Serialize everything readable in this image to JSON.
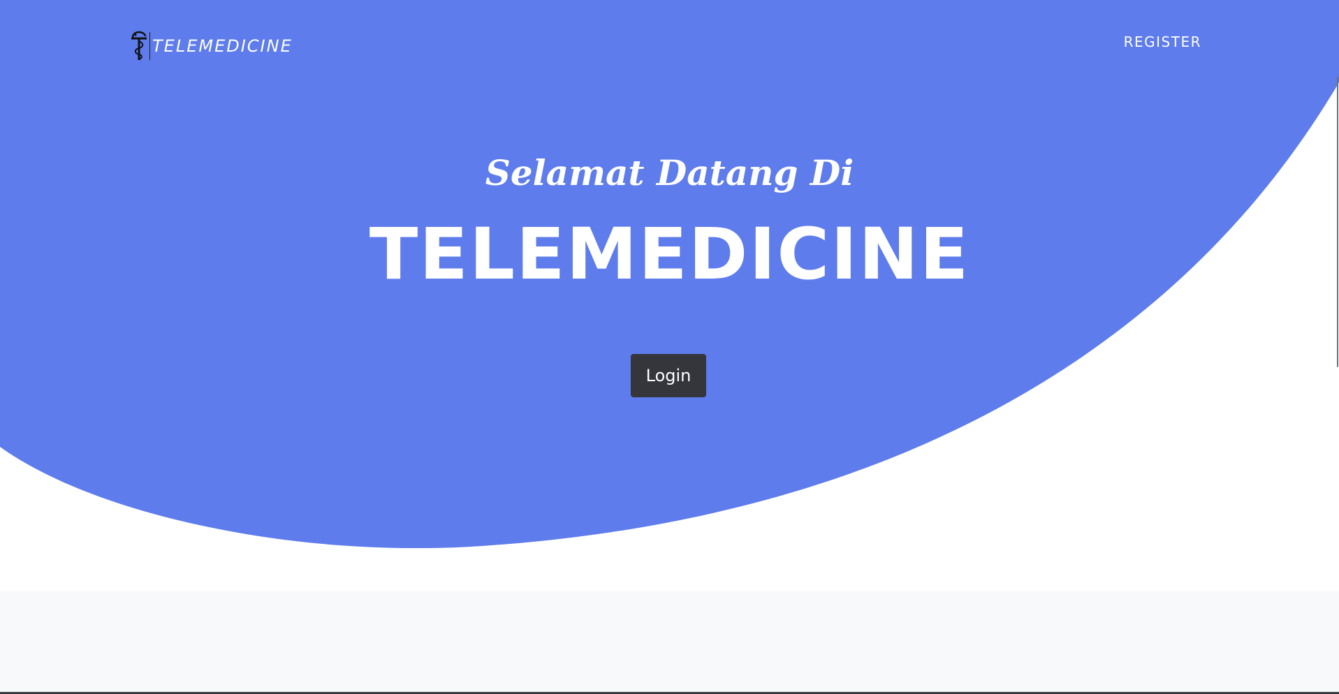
{
  "navbar": {
    "brand_text": "TELEMEDICINE",
    "brand_icon": "caduceus-logo-icon",
    "register_label": "REGISTER"
  },
  "hero": {
    "subtitle": "Selamat Datang Di",
    "title": "TELEMEDICINE",
    "login_label": "Login"
  },
  "colors": {
    "hero_blue": "#5e7ceb",
    "button_dark": "#34363c",
    "lower_band": "#f8f9fb",
    "white": "#ffffff"
  }
}
